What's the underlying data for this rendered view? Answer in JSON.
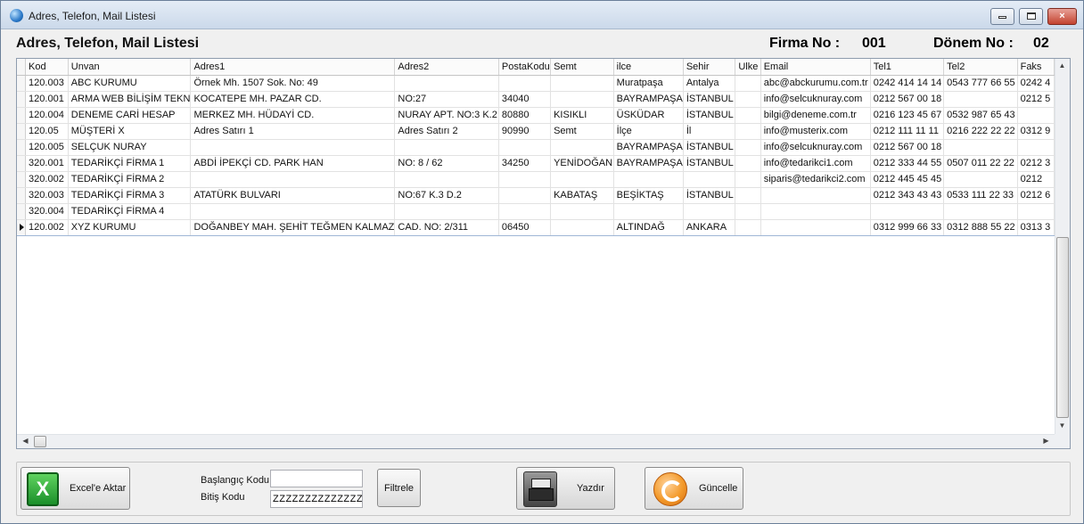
{
  "window": {
    "title": "Adres, Telefon, Mail Listesi",
    "controls": {
      "minimize": "",
      "maximize": "",
      "close": "×"
    }
  },
  "header": {
    "title": "Adres, Telefon, Mail Listesi",
    "firma_label": "Firma No :",
    "firma_value": "001",
    "donem_label": "Dönem No :",
    "donem_value": "02"
  },
  "grid": {
    "columns": [
      "Kod",
      "Unvan",
      "Adres1",
      "Adres2",
      "PostaKodu",
      "Semt",
      "ilce",
      "Sehir",
      "Ulke",
      "Email",
      "Tel1",
      "Tel2",
      "Faks"
    ],
    "rows": [
      [
        "120.003",
        "ABC KURUMU",
        "Örnek Mh. 1507 Sok. No: 49",
        "",
        "",
        "",
        "Muratpaşa",
        "Antalya",
        "",
        "abc@abckurumu.com.tr",
        "0242 414 14 14",
        "0543 777 66 55",
        "0242 4"
      ],
      [
        "120.001",
        "ARMA WEB BİLİŞİM TEKN",
        "KOCATEPE MH. PAZAR CD.",
        "NO:27",
        "34040",
        "",
        "BAYRAMPAŞA",
        "İSTANBUL",
        "",
        "info@selcuknuray.com",
        "0212 567 00 18",
        "",
        "0212 5"
      ],
      [
        "120.004",
        "DENEME CARİ HESAP",
        "MERKEZ MH. HÜDAYİ CD.",
        "NURAY APT. NO:3 K.2",
        "80880",
        "KISIKLI",
        "ÜSKÜDAR",
        "İSTANBUL",
        "",
        "bilgi@deneme.com.tr",
        "0216 123 45 67",
        "0532 987 65 43",
        ""
      ],
      [
        "120.05",
        "MÜŞTERİ X",
        "Adres Satırı 1",
        "Adres Satırı 2",
        "90990",
        "Semt",
        "İlçe",
        "İl",
        "",
        "info@musterix.com",
        "0212 111 11 11",
        "0216 222 22 22",
        "0312 9"
      ],
      [
        "120.005",
        "SELÇUK NURAY",
        "",
        "",
        "",
        "",
        "BAYRAMPAŞA",
        "İSTANBUL",
        "",
        "info@selcuknuray.com",
        "0212 567 00 18",
        "",
        ""
      ],
      [
        "320.001",
        "TEDARİKÇİ FİRMA 1",
        "ABDİ İPEKÇİ CD. PARK HAN",
        "NO: 8 / 62",
        "34250",
        "YENİDOĞAN",
        "BAYRAMPAŞA",
        "İSTANBUL",
        "",
        "info@tedarikci1.com",
        "0212  333 44 55",
        "0507 011 22 22",
        "0212 3"
      ],
      [
        "320.002",
        "TEDARİKÇİ FİRMA 2",
        "",
        "",
        "",
        "",
        "",
        "",
        "",
        "siparis@tedarikci2.com",
        "0212 445 45 45",
        "",
        "0212"
      ],
      [
        "320.003",
        "TEDARİKÇİ FİRMA 3",
        "ATATÜRK BULVARI",
        "NO:67 K.3 D.2",
        "",
        "KABATAŞ",
        "BEŞİKTAŞ",
        "İSTANBUL",
        "",
        "",
        "0212 343 43 43",
        "0533 111 22 33",
        "0212 6"
      ],
      [
        "320.004",
        "TEDARİKÇİ FİRMA 4",
        "",
        "",
        "",
        "",
        "",
        "",
        "",
        "",
        "",
        "",
        ""
      ],
      [
        "120.002",
        "XYZ KURUMU",
        "DOĞANBEY MAH. ŞEHİT TEĞMEN KALMAZ",
        "CAD. NO: 2/311",
        "06450",
        "",
        "ALTINDAĞ",
        "ANKARA",
        "",
        "",
        "0312  999 66 33",
        "0312 888 55 22",
        "0313 3"
      ]
    ],
    "current_row": 9,
    "scroll_arrows": {
      "up": "▲",
      "down": "▼",
      "left": "◀",
      "right": "▶"
    }
  },
  "bottom": {
    "excel_icon": "X",
    "excel_label": "Excel'e Aktar",
    "start_code_label": "Başlangıç Kodu",
    "start_code_value": "",
    "end_code_label": "Bitiş Kodu",
    "end_code_value": "ZZZZZZZZZZZZZZZZ",
    "filter_label": "Filtrele",
    "print_label": "Yazdır",
    "update_label": "Güncelle"
  },
  "colors": {
    "close_button": "#c3422f",
    "excel_green": "#1b8f2a",
    "update_orange": "#f39a2b"
  },
  "icons": [
    "app-globe-icon",
    "excel-icon",
    "printer-icon",
    "refresh-icon"
  ]
}
